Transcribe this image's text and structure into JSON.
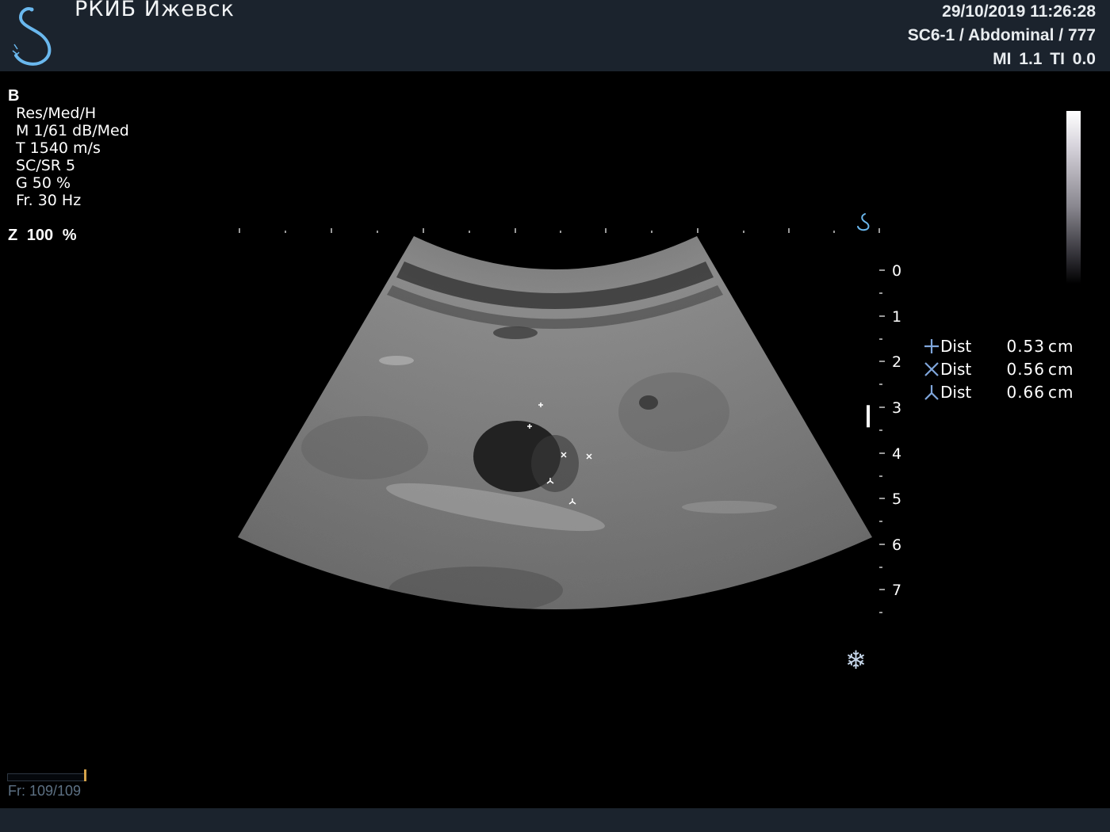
{
  "header": {
    "facility": "РКИБ Ижевск",
    "datetime": "29/10/2019 11:26:28",
    "probe_preset": "SC6-1 / Abdominal / 777",
    "indices": "MI 1.1  TI 0.0",
    "logo_icon": "swan-logo-icon"
  },
  "params": {
    "mode": "B",
    "lines": [
      "Res/Med/H",
      "M 1/61 dB/Med",
      "T 1540 m/s",
      "SC/SR 5",
      "G 50 %",
      "Fr. 30 Hz"
    ],
    "zoom": "Z  100  %"
  },
  "depth_scale": {
    "labels": [
      "0",
      "1",
      "2",
      "3",
      "4",
      "5",
      "6",
      "7"
    ],
    "focus_depth_cm": 3.2,
    "max_depth_cm": 7.5
  },
  "measurements": [
    {
      "marker": "plus",
      "label": "Dist",
      "value": "0.53",
      "unit": "cm"
    },
    {
      "marker": "cross",
      "label": "Dist",
      "value": "0.56",
      "unit": "cm"
    },
    {
      "marker": "tri",
      "label": "Dist",
      "value": "0.66",
      "unit": "cm"
    }
  ],
  "freeze_icon": "snowflake-icon",
  "freeze_glyph": "❄",
  "cine": {
    "frame_label": "Fr: 109/109",
    "progress": 1.0
  },
  "colors": {
    "header_bg": "#1b232d",
    "accent_blue": "#6ab8ee",
    "marker_blue": "#7fa6dc",
    "cine_marker": "#d4a24a"
  }
}
